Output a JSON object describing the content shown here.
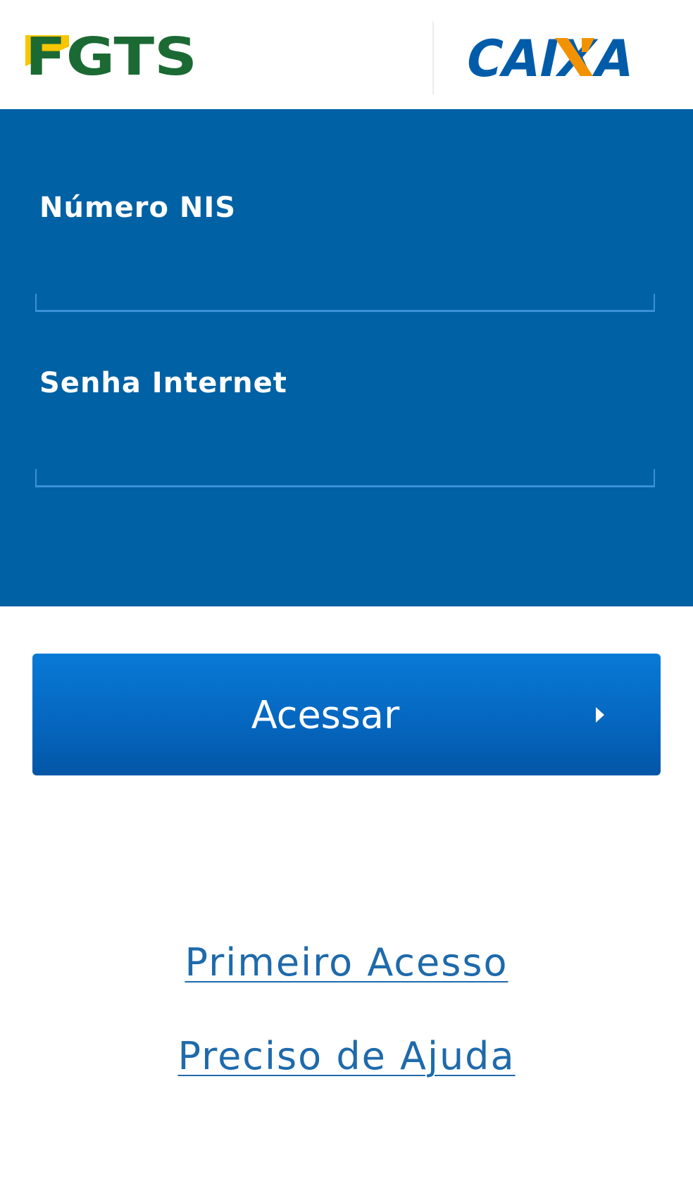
{
  "header": {
    "fgts_logo_text": "FGTS",
    "caixa_logo_text": "CAIXA"
  },
  "login": {
    "nis_label": "Número NIS",
    "nis_value": "",
    "password_label": "Senha Internet",
    "password_value": ""
  },
  "actions": {
    "access_label": "Acessar",
    "first_access_label": "Primeiro Acesso",
    "help_label": "Preciso de Ajuda"
  },
  "icons": {
    "access_arrow": "chevron-right-icon"
  },
  "colors": {
    "panel_blue": "#0061a4",
    "button_blue": "#0567c0",
    "link_blue": "#1e6aab",
    "fgts_green": "#1b6a34",
    "fgts_yellow": "#f7c600",
    "caixa_blue": "#005ca9",
    "caixa_orange": "#f39200"
  }
}
